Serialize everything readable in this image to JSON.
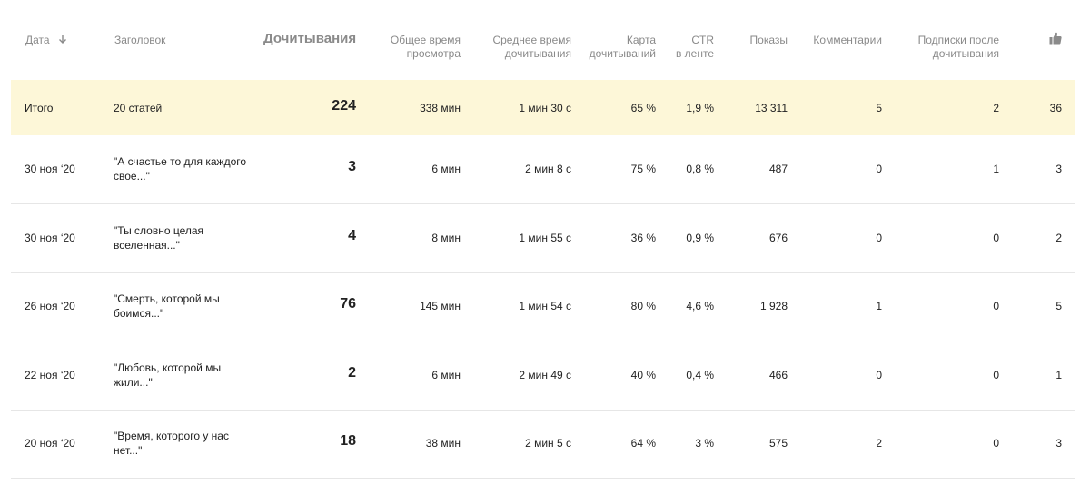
{
  "columns": {
    "date": "Дата",
    "title": "Заголовок",
    "reads": "Дочитывания",
    "total_time_1": "Общее время",
    "total_time_2": "просмотра",
    "avg_time_1": "Среднее время",
    "avg_time_2": "дочитывания",
    "map_1": "Карта",
    "map_2": "дочитываний",
    "ctr_1": "CTR",
    "ctr_2": "в ленте",
    "views": "Показы",
    "comments": "Комментарии",
    "subs_1": "Подписки после",
    "subs_2": "дочитывания",
    "likes_icon": "thumbs-up-icon",
    "sort_icon": "arrow-down-icon"
  },
  "total": {
    "date": "Итого",
    "title": "20 статей",
    "reads": "224",
    "total_time": "338 мин",
    "avg_time": "1 мин 30 с",
    "map": "65 %",
    "ctr": "1,9 %",
    "views": "13 311",
    "comments": "5",
    "subs": "2",
    "likes": "36"
  },
  "rows": [
    {
      "date": "30 ноя ‘20",
      "title_1": "\"А счастье то для каждого",
      "title_2": "свое...\"",
      "reads": "3",
      "total_time": "6 мин",
      "avg_time": "2 мин 8 с",
      "map": "75 %",
      "ctr": "0,8 %",
      "views": "487",
      "comments": "0",
      "subs": "1",
      "likes": "3"
    },
    {
      "date": "30 ноя ‘20",
      "title_1": "\"Ты словно целая",
      "title_2": "вселенная...\"",
      "reads": "4",
      "total_time": "8 мин",
      "avg_time": "1 мин 55 с",
      "map": "36 %",
      "ctr": "0,9 %",
      "views": "676",
      "comments": "0",
      "subs": "0",
      "likes": "2"
    },
    {
      "date": "26 ноя ‘20",
      "title_1": "\"Смерть, которой мы",
      "title_2": "боимся...\"",
      "reads": "76",
      "total_time": "145 мин",
      "avg_time": "1 мин 54 с",
      "map": "80 %",
      "ctr": "4,6 %",
      "views": "1 928",
      "comments": "1",
      "subs": "0",
      "likes": "5"
    },
    {
      "date": "22 ноя ‘20",
      "title_1": "\"Любовь, которой мы",
      "title_2": "жили...\"",
      "reads": "2",
      "total_time": "6 мин",
      "avg_time": "2 мин 49 с",
      "map": "40 %",
      "ctr": "0,4 %",
      "views": "466",
      "comments": "0",
      "subs": "0",
      "likes": "1"
    },
    {
      "date": "20 ноя ‘20",
      "title_1": "\"Время, которого у нас",
      "title_2": "нет...\"",
      "reads": "18",
      "total_time": "38 мин",
      "avg_time": "2 мин 5 с",
      "map": "64 %",
      "ctr": "3 %",
      "views": "575",
      "comments": "2",
      "subs": "0",
      "likes": "3"
    }
  ]
}
